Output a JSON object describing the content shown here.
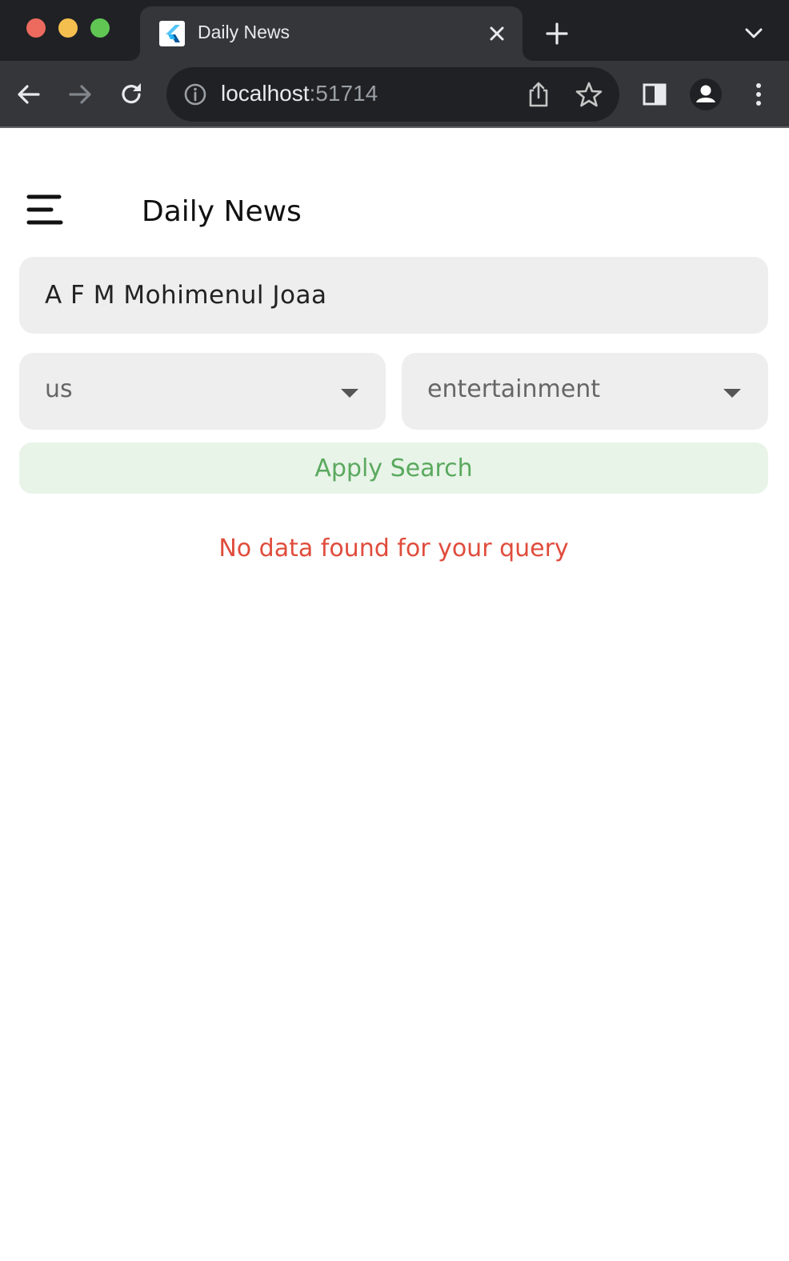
{
  "browser": {
    "tab": {
      "title": "Daily News"
    },
    "address": {
      "host": "localhost",
      "port": ":51714"
    }
  },
  "app": {
    "title": "Daily News",
    "search": {
      "value": "A F M Mohimenul Joaa"
    },
    "country_dropdown": {
      "selected": "us"
    },
    "category_dropdown": {
      "selected": "entertainment"
    },
    "apply_button": {
      "label": "Apply Search"
    },
    "empty_message": "No data found for your query"
  },
  "colors": {
    "apply_text": "#5aa95e",
    "apply_bg": "#e8f4e8",
    "error_text": "#e04c3c",
    "field_bg": "#eeeeee"
  },
  "icons": {
    "tab_favicon": "flutter-icon",
    "tab_close": "close-icon",
    "new_tab": "plus-icon",
    "tab_menu": "chevron-down-icon",
    "back": "arrow-left-icon",
    "forward": "arrow-right-icon",
    "reload": "reload-icon",
    "site_info": "info-icon",
    "share": "share-icon",
    "bookmark": "star-icon",
    "side_panel": "side-panel-icon",
    "profile": "profile-icon",
    "more": "kebab-menu-icon",
    "drawer": "menu-icon",
    "dropdown": "caret-down-icon"
  }
}
